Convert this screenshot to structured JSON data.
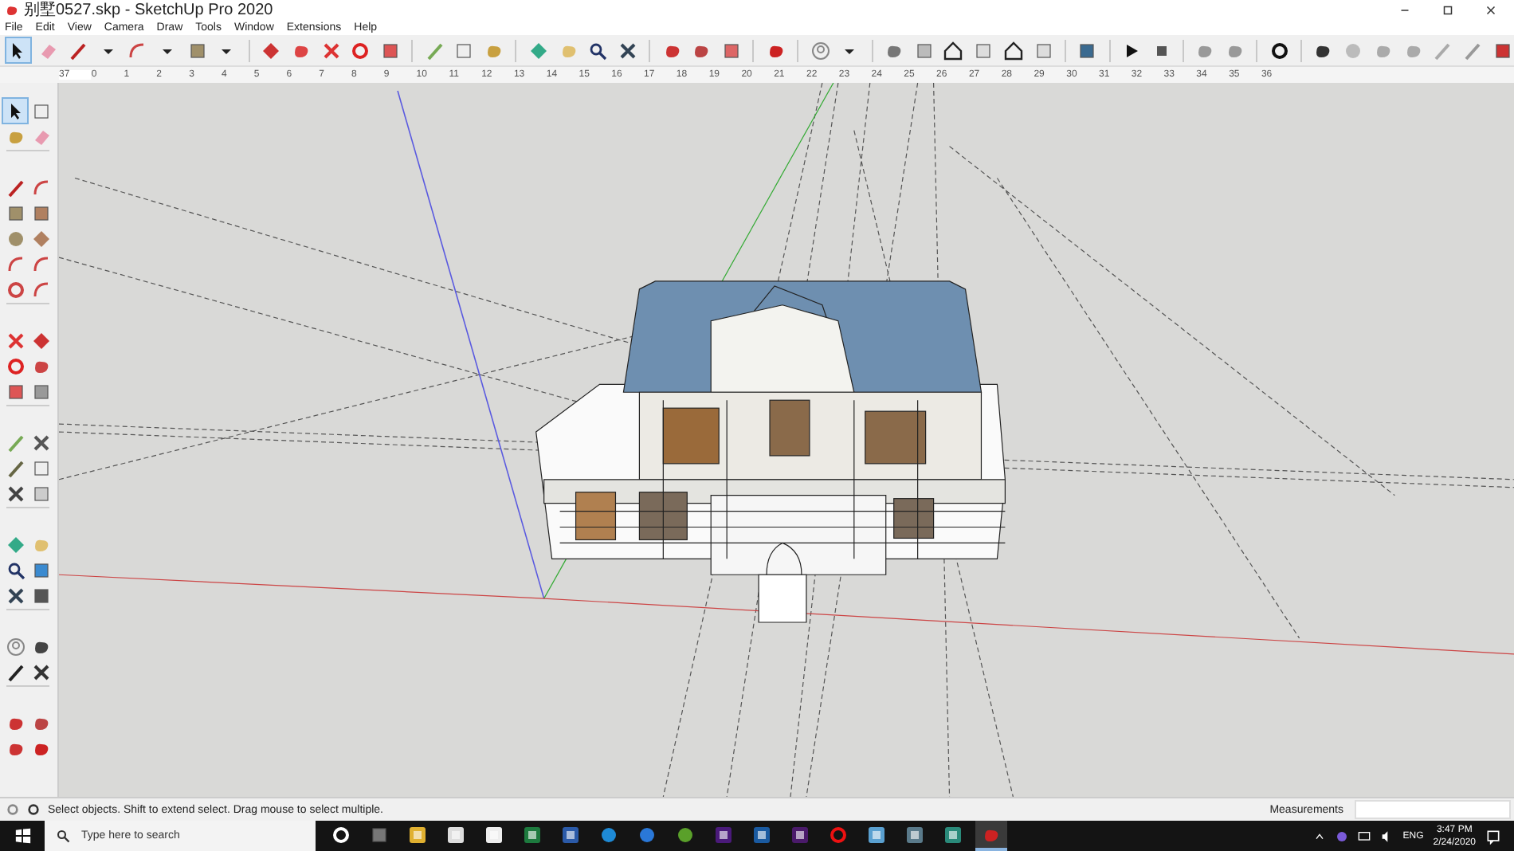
{
  "window": {
    "title": "别墅0527.skp - SketchUp Pro 2020"
  },
  "menu": [
    "File",
    "Edit",
    "View",
    "Camera",
    "Draw",
    "Tools",
    "Window",
    "Extensions",
    "Help"
  ],
  "main_toolbar": {
    "select_tool": {
      "selected": true
    }
  },
  "ruler": {
    "marks": [
      "37",
      "0",
      "1",
      "2",
      "3",
      "4",
      "5",
      "6",
      "7",
      "8",
      "9",
      "10",
      "11",
      "12",
      "13",
      "14",
      "15",
      "16",
      "17",
      "18",
      "19",
      "20",
      "21",
      "22",
      "23",
      "24",
      "25",
      "26",
      "27",
      "28",
      "29",
      "30",
      "31",
      "32",
      "33",
      "34",
      "35",
      "36"
    ]
  },
  "large_tool_set": {
    "select_tool": {
      "selected": true
    }
  },
  "status_bar": {
    "hint": "Select objects. Shift to extend select. Drag mouse to select multiple.",
    "measurements_label": "Measurements"
  },
  "taskbar": {
    "search": {
      "placeholder": "Type here to search"
    },
    "apps": [
      {
        "active": false
      },
      {
        "active": false
      },
      {
        "active": false
      },
      {
        "active": false
      },
      {
        "active": false
      },
      {
        "active": false
      },
      {
        "active": false
      },
      {
        "active": false
      },
      {
        "active": false
      },
      {
        "active": false
      },
      {
        "active": false
      },
      {
        "active": false
      },
      {
        "active": false
      },
      {
        "active": false
      },
      {
        "active": false
      },
      {
        "active": false
      },
      {
        "active": false
      },
      {
        "active": true
      }
    ],
    "language": "ENG",
    "time": "3:47 PM",
    "date": "2/24/2020"
  }
}
